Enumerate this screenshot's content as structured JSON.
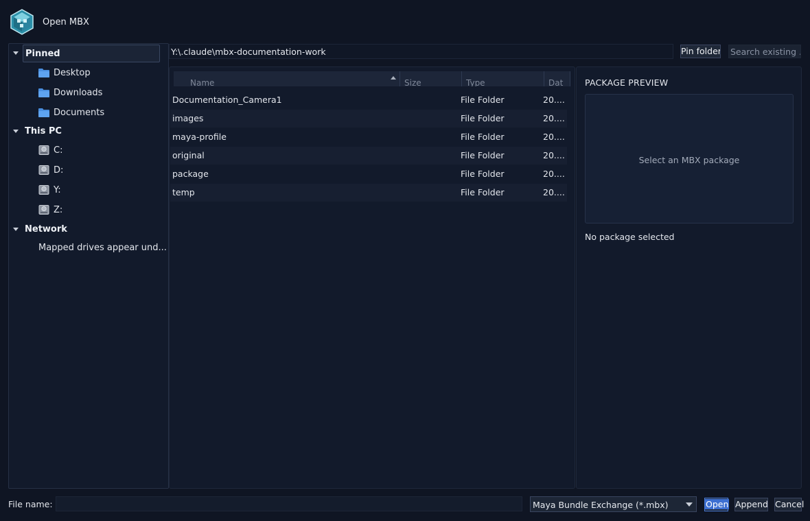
{
  "window": {
    "title": "Open MBX",
    "logo_icon": "mbx-cube-icon"
  },
  "sidebar": {
    "groups": [
      {
        "label": "Pinned",
        "items": [
          {
            "label": "Desktop",
            "icon": "folder-icon"
          },
          {
            "label": "Downloads",
            "icon": "folder-icon"
          },
          {
            "label": "Documents",
            "icon": "folder-icon"
          }
        ]
      },
      {
        "label": "This PC",
        "items": [
          {
            "label": "C:",
            "icon": "drive-icon"
          },
          {
            "label": "D:",
            "icon": "drive-icon"
          },
          {
            "label": "Y:",
            "icon": "drive-icon"
          },
          {
            "label": "Z:",
            "icon": "drive-icon"
          }
        ]
      },
      {
        "label": "Network",
        "note": "Mapped drives appear und..."
      }
    ]
  },
  "path_bar": {
    "path": "Y:\\.claude\\mbx-documentation-work",
    "pin_label": "Pin folder",
    "search_placeholder": "Search existing ..."
  },
  "file_list": {
    "columns": [
      "Name",
      "Size",
      "Type",
      "Dat"
    ],
    "sort_column": "Name",
    "rows": [
      {
        "name": "Documentation_Camera1",
        "size": "",
        "type": "File Folder",
        "date": "20...."
      },
      {
        "name": "images",
        "size": "",
        "type": "File Folder",
        "date": "20...."
      },
      {
        "name": "maya-profile",
        "size": "",
        "type": "File Folder",
        "date": "20...."
      },
      {
        "name": "original",
        "size": "",
        "type": "File Folder",
        "date": "20...."
      },
      {
        "name": "package",
        "size": "",
        "type": "File Folder",
        "date": "20...."
      },
      {
        "name": "temp",
        "size": "",
        "type": "File Folder",
        "date": "20...."
      }
    ]
  },
  "preview": {
    "title": "PACKAGE PREVIEW",
    "placeholder": "Select an MBX package",
    "status": "No package selected"
  },
  "footer": {
    "file_name_label": "File name:",
    "file_name_value": "",
    "file_type": "Maya Bundle Exchange (*.mbx)",
    "open_label": "Open",
    "append_label": "Append",
    "cancel_label": "Cancel"
  },
  "colors": {
    "background": "#0f1523",
    "panel": "#121a2b",
    "accent": "#3d6fd1",
    "folder": "#4a8fe0"
  }
}
